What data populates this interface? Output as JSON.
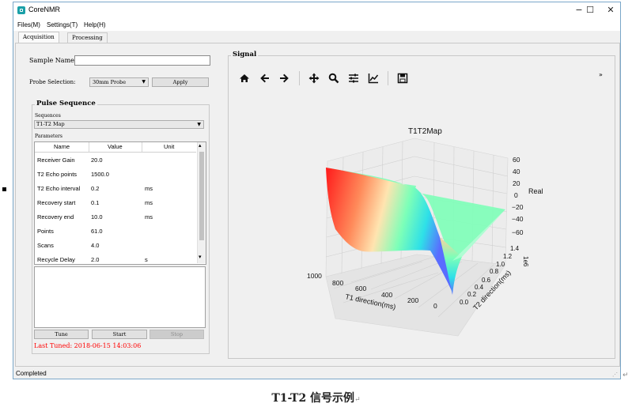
{
  "app": {
    "title": "CoreNMR",
    "icon": "corenmr-app-icon"
  },
  "window_controls": {
    "minimize": "−",
    "maximize": "☐",
    "close": "✕"
  },
  "menu": [
    "Files(M)",
    "Settings(T)",
    "Help(H)"
  ],
  "tabs": [
    {
      "label": "Acquisition",
      "active": true
    },
    {
      "label": "Processing",
      "active": false
    }
  ],
  "acquisition": {
    "sample_name_label": "Sample Name",
    "sample_name_value": "",
    "probe_label": "Probe Selection:",
    "probe_value": "30mm Probe",
    "apply_label": "Apply",
    "pulse_group_title": "Pulse Sequence",
    "sequences_label": "Sequences",
    "sequence_value": "T1-T2 Map",
    "parameters_label": "Parameters",
    "param_headers": [
      "Name",
      "Value",
      "Unit"
    ],
    "params": [
      {
        "name": "Receiver Gain",
        "value": "20.0",
        "unit": ""
      },
      {
        "name": "T2 Echo points",
        "value": "1500.0",
        "unit": ""
      },
      {
        "name": "T2 Echo interval",
        "value": "0.2",
        "unit": "ms"
      },
      {
        "name": "Recovery start",
        "value": "0.1",
        "unit": "ms"
      },
      {
        "name": "Recovery end",
        "value": "10.0",
        "unit": "ms"
      },
      {
        "name": "Points",
        "value": "61.0",
        "unit": ""
      },
      {
        "name": "Scans",
        "value": "4.0",
        "unit": ""
      },
      {
        "name": "Recycle Delay",
        "value": "2.0",
        "unit": "s"
      }
    ],
    "log_text": "",
    "tune_label": "Tune",
    "start_label": "Start",
    "stop_label": "Stop",
    "last_tuned": "Last Tuned: 2018-06-15 14:03:06",
    "last_tuned_color": "#ff0000"
  },
  "signal": {
    "group_title": "Signal",
    "toolbar": [
      "home-icon",
      "back-arrow-icon",
      "forward-arrow-icon",
      "pan-icon",
      "zoom-icon",
      "subplots-config-icon",
      "axes-edit-icon",
      "save-icon"
    ],
    "overflow": "»"
  },
  "chart_data": {
    "type": "surface3d",
    "title": "T1T2Map",
    "xlabel": "T1 direction(ms)",
    "ylabel": "T2 direction(ms)",
    "zlabel": "Real",
    "x_ticks": [
      "1000",
      "800",
      "600",
      "400",
      "200",
      "0"
    ],
    "y_ticks": [
      "0.0",
      "0.2",
      "0.4",
      "0.6",
      "0.8",
      "1.0",
      "1.2",
      "1.4"
    ],
    "y_multiplier": "1e6",
    "z_ticks": [
      "60",
      "40",
      "20",
      "0",
      "−20",
      "−40",
      "−60"
    ],
    "xlim": [
      0,
      1000
    ],
    "ylim": [
      0,
      1400000
    ],
    "zlim": [
      -60,
      60
    ],
    "colormap": [
      "#ff1a1a",
      "#ff8a5a",
      "#ffe4b0",
      "#7dffb8",
      "#2ee0e8",
      "#5a6cff"
    ],
    "surface_description_points": [
      {
        "t1": 1000,
        "t2": 0,
        "real": 60
      },
      {
        "t1": 0,
        "t2": 0,
        "real": -60
      },
      {
        "t1": 1000,
        "t2": 1400000,
        "real": 20
      },
      {
        "t1": 0,
        "t2": 1400000,
        "real": 0
      }
    ]
  },
  "status": "Completed",
  "caption": "T1-T2 信号示例",
  "caption_mark": "↵",
  "edge_mark": "↵"
}
